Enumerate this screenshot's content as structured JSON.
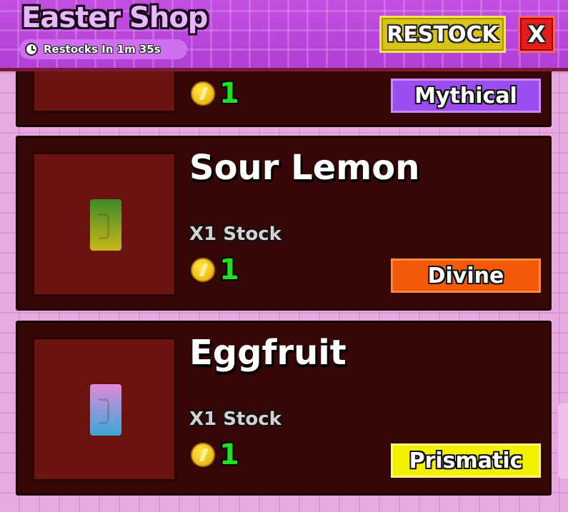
{
  "header": {
    "title": "Easter Shop",
    "restock_timer": "Restocks In 1m 35s",
    "restock_button": "RESTOCK",
    "close_button": "X"
  },
  "items": [
    {
      "name": "",
      "stock": "",
      "price": "1",
      "rarity": "Mythical",
      "rarity_color": "#9b4df0",
      "rarity_border": "#c98cff",
      "pack_colors": [
        "#6c3c1c",
        "#6c3c1c"
      ]
    },
    {
      "name": "Sour Lemon",
      "stock": "X1 Stock",
      "price": "1",
      "rarity": "Divine",
      "rarity_color": "#f25a0a",
      "rarity_border": "#ff8a3a",
      "pack_colors": [
        "#3f8a2a",
        "#c9b81a"
      ]
    },
    {
      "name": "Eggfruit",
      "stock": "X1 Stock",
      "price": "1",
      "rarity": "Prismatic",
      "rarity_color": "#f5f000",
      "rarity_border": "#fffb80",
      "pack_colors": [
        "#e08ad8",
        "#3aa8d8"
      ]
    }
  ],
  "icons": [
    "clock-icon",
    "coin-icon",
    "close-icon"
  ]
}
